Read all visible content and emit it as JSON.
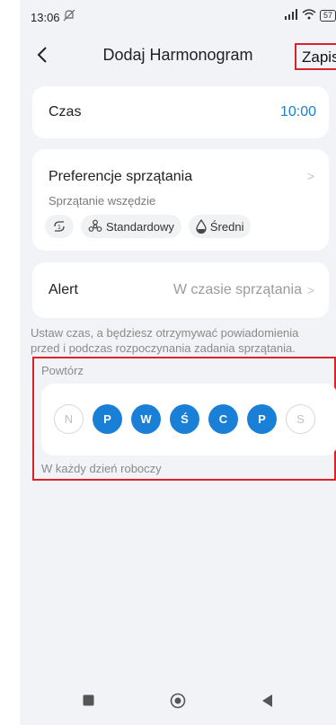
{
  "status_bar": {
    "time": "13:06",
    "battery": "57"
  },
  "header": {
    "title": "Dodaj Harmonogram",
    "save_label": "Zapis"
  },
  "time_card": {
    "label": "Czas",
    "value": "10:00"
  },
  "pref_card": {
    "label": "Preferencje sprzątania",
    "subtitle": "Sprzątanie wszędzie",
    "chips": [
      {
        "icon": "cycle-icon",
        "label": ""
      },
      {
        "icon": "fan-icon",
        "label": "Standardowy"
      },
      {
        "icon": "water-drop-icon",
        "label": "Średni"
      }
    ]
  },
  "alert_card": {
    "label": "Alert",
    "value": "W czasie sprzątania"
  },
  "note": "Ustaw czas, a będziesz otrzymywać powiadomienia przed i podczas rozpoczynania zadania sprzątania.",
  "repeat": {
    "label": "Powtórz",
    "days": [
      {
        "letter": "N",
        "selected": false
      },
      {
        "letter": "P",
        "selected": true
      },
      {
        "letter": "W",
        "selected": true
      },
      {
        "letter": "Ś",
        "selected": true
      },
      {
        "letter": "C",
        "selected": true
      },
      {
        "letter": "P",
        "selected": true
      },
      {
        "letter": "S",
        "selected": false
      }
    ],
    "hint": "W każdy dzień roboczy"
  },
  "colors": {
    "accent": "#1a7fd6",
    "highlight": "#d9232b"
  }
}
